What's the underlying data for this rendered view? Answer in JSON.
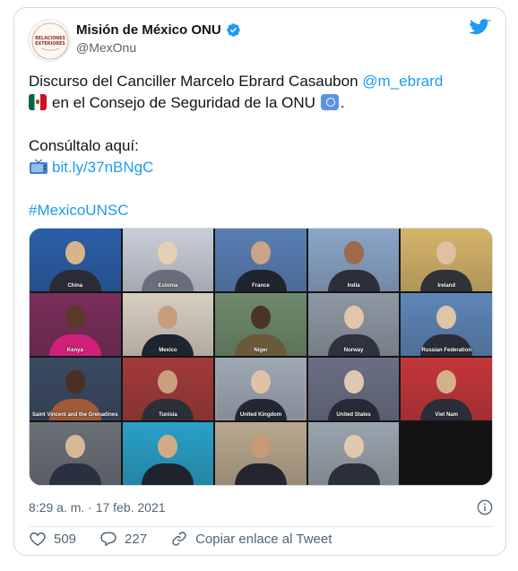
{
  "author": {
    "display_name": "Misión de México ONU",
    "handle": "@MexOnu",
    "avatar_text_line1": "RELACIONES",
    "avatar_text_line2": "EXTERIORES",
    "verified": true
  },
  "tweet": {
    "line1_text": "Discurso del Canciller Marcelo Ebrard Casaubon ",
    "line1_mention": "@m_ebrard",
    "line2_text": "en el Consejo de Seguridad de la ONU",
    "line2_end": ".",
    "line3_text": "Consúltalo aquí:",
    "link_text": "bit.ly/37nBNgC",
    "hashtag": "#MexicoUNSC"
  },
  "media": {
    "tiles": [
      {
        "label": "China",
        "bg": "#2a5fa8",
        "head": "#d8b48c",
        "body": "#2b2b35"
      },
      {
        "label": "Estonia",
        "bg": "#c9ced6",
        "head": "#e6cfb4",
        "body": "#6a6e7a"
      },
      {
        "label": "France",
        "bg": "#5a7fb5",
        "head": "#caa484",
        "body": "#20242e"
      },
      {
        "label": "India",
        "bg": "#8aa6c8",
        "head": "#9b6b4c",
        "body": "#2a2f3a"
      },
      {
        "label": "Ireland",
        "bg": "#d6b46a",
        "head": "#e0c0a0",
        "body": "#30323a"
      },
      {
        "label": "Kenya",
        "bg": "#7a2e5a",
        "head": "#5a3a2a",
        "body": "#d0207a"
      },
      {
        "label": "Mexico",
        "bg": "#d8cfc2",
        "head": "#c79d7c",
        "body": "#1e2430"
      },
      {
        "label": "Niger",
        "bg": "#6f8a6c",
        "head": "#4a3426",
        "body": "#6a5a3a"
      },
      {
        "label": "Norway",
        "bg": "#8e98a4",
        "head": "#e2c6ac",
        "body": "#2e333c"
      },
      {
        "label": "Russian Federation",
        "bg": "#5d86b8",
        "head": "#e0c4a8",
        "body": "#2a2d38"
      },
      {
        "label": "Saint Vincent and the Grenadines",
        "bg": "#3b4a62",
        "head": "#4a3022",
        "body": "#a05a3a"
      },
      {
        "label": "Tunisia",
        "bg": "#a33a3a",
        "head": "#c9a080",
        "body": "#2c2f3a"
      },
      {
        "label": "United Kingdom",
        "bg": "#9fa9b6",
        "head": "#e0c2a6",
        "body": "#222833"
      },
      {
        "label": "United States",
        "bg": "#6a6f85",
        "head": "#e0c8b0",
        "body": "#252a36"
      },
      {
        "label": "Viet Nam",
        "bg": "#c4363a",
        "head": "#d4b08a",
        "body": "#2a2e38"
      },
      {
        "label": "",
        "bg": "#6b7078",
        "head": "#d8b896",
        "body": "#2a3040"
      },
      {
        "label": "",
        "bg": "#2aa0c8",
        "head": "#d2aa88",
        "body": "#1e232d"
      },
      {
        "label": "",
        "bg": "#b9a88e",
        "head": "#c69a76",
        "body": "#23262e"
      },
      {
        "label": "",
        "bg": "#9aa4ae",
        "head": "#e2c8ae",
        "body": "#2a2f38"
      },
      {
        "label": "",
        "bg": "#121212",
        "head": "#121212",
        "body": "#121212"
      }
    ]
  },
  "meta": {
    "timestamp": "8:29 a. m. · 17 feb. 2021"
  },
  "actions": {
    "likes": "509",
    "replies": "227",
    "copy_link": "Copiar enlace al Tweet"
  },
  "colors": {
    "link": "#1d9bf0",
    "secondary_text": "#536471",
    "border": "#cfd9de",
    "like_icon": "#536471"
  },
  "icons": {
    "verified": "verified-badge-icon",
    "twitter": "twitter-bird-icon",
    "info": "info-icon",
    "like": "heart-icon",
    "reply": "reply-bubble-icon",
    "copy": "link-chain-icon",
    "tv": "television-icon"
  }
}
